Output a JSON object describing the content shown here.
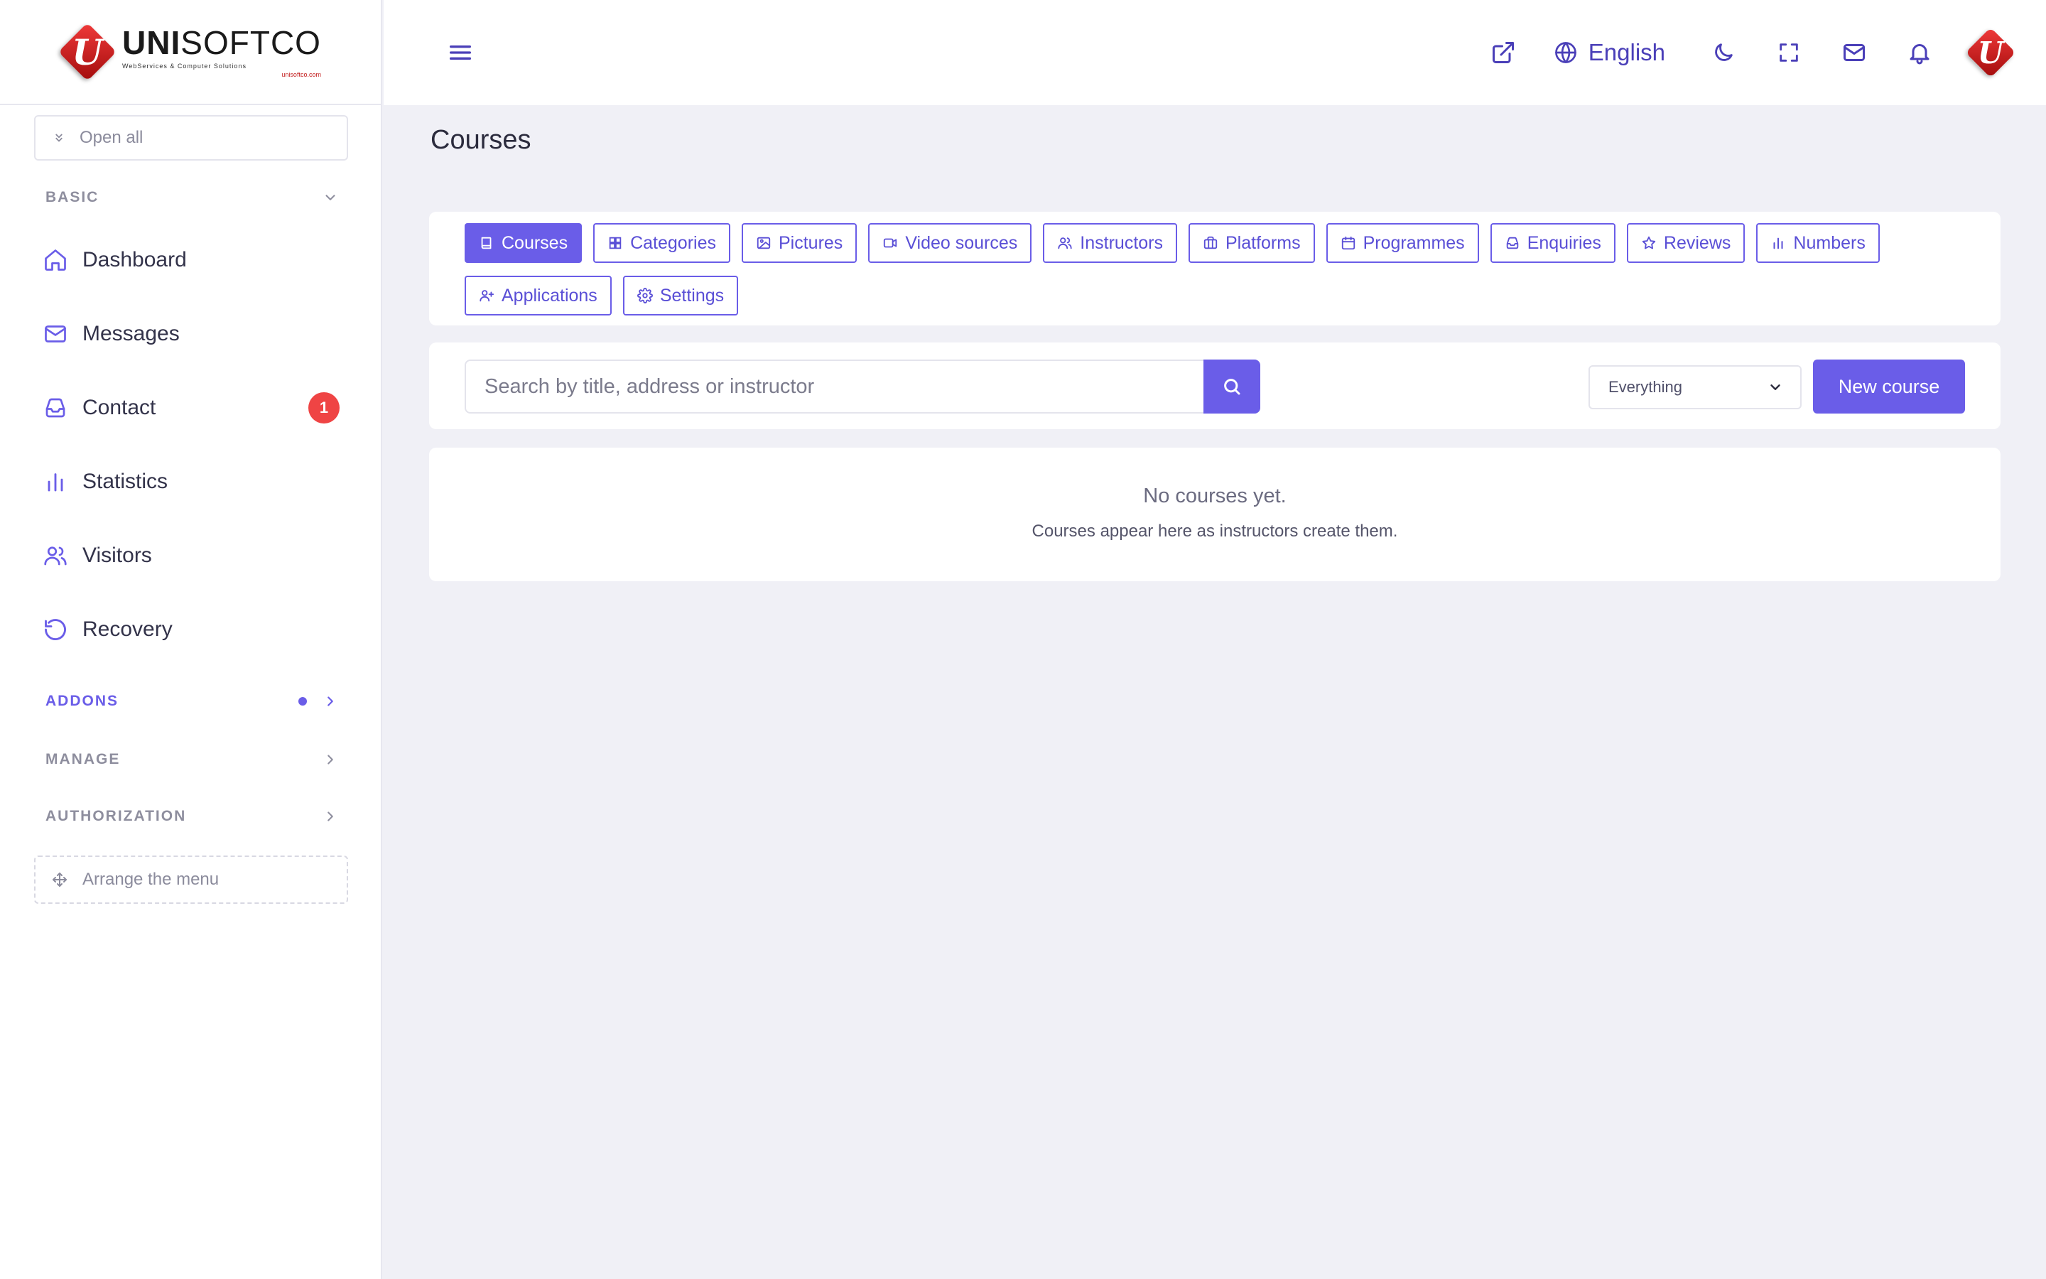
{
  "brand": {
    "name_bold": "UNI",
    "name_light": "SOFTCO",
    "tagline": "WebServices & Computer Solutions",
    "url": "unisoftco.com",
    "mark_letter": "U"
  },
  "sidebar": {
    "open_all_label": "Open all",
    "sections": {
      "basic": "BASIC",
      "addons": "ADDONS",
      "manage": "MANAGE",
      "authorization": "AUTHORIZATION"
    },
    "items": [
      {
        "label": "Dashboard",
        "icon": "home-icon"
      },
      {
        "label": "Messages",
        "icon": "mail-icon"
      },
      {
        "label": "Contact",
        "icon": "inbox-icon",
        "badge": "1"
      },
      {
        "label": "Statistics",
        "icon": "bar-chart-icon"
      },
      {
        "label": "Visitors",
        "icon": "users-icon"
      },
      {
        "label": "Recovery",
        "icon": "history-icon"
      }
    ],
    "arrange_label": "Arrange the menu"
  },
  "topbar": {
    "language": "English"
  },
  "page": {
    "title": "Courses"
  },
  "tabs": [
    {
      "label": "Courses",
      "icon": "book-icon",
      "active": true
    },
    {
      "label": "Categories",
      "icon": "grid-icon"
    },
    {
      "label": "Pictures",
      "icon": "image-icon"
    },
    {
      "label": "Video sources",
      "icon": "video-icon"
    },
    {
      "label": "Instructors",
      "icon": "users-icon"
    },
    {
      "label": "Platforms",
      "icon": "briefcase-icon"
    },
    {
      "label": "Programmes",
      "icon": "calendar-icon"
    },
    {
      "label": "Enquiries",
      "icon": "inbox-icon"
    },
    {
      "label": "Reviews",
      "icon": "star-icon"
    },
    {
      "label": "Numbers",
      "icon": "bar-chart-icon"
    },
    {
      "label": "Applications",
      "icon": "user-plus-icon"
    },
    {
      "label": "Settings",
      "icon": "gear-icon"
    }
  ],
  "search": {
    "placeholder": "Search by title, address or instructor",
    "value": ""
  },
  "filter": {
    "selected": "Everything"
  },
  "new_button_label": "New course",
  "empty_state": {
    "title": "No courses yet.",
    "subtitle": "Courses appear here as instructors create them."
  },
  "colors": {
    "accent": "#6a5de8",
    "badge": "#ef4444",
    "background": "#f0f0f6"
  }
}
